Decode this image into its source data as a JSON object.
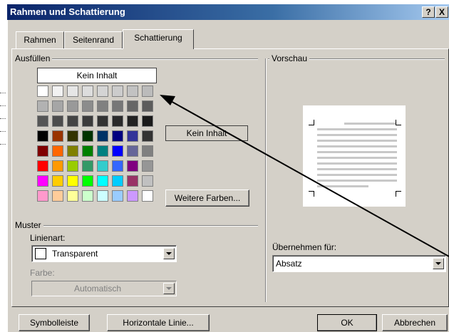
{
  "dialog": {
    "title": "Rahmen und Schattierung",
    "help_label": "?",
    "close_label": "X"
  },
  "tabs": [
    {
      "label": "Rahmen",
      "selected": false
    },
    {
      "label": "Seitenrand",
      "selected": false
    },
    {
      "label": "Schattierung",
      "selected": true
    }
  ],
  "fill": {
    "group_label": "Ausfüllen",
    "no_fill_label": "Kein Inhalt",
    "selected_label": "Kein Inhalt",
    "more_colors_label": "Weitere Farben...",
    "palette": [
      [
        "#ffffff",
        "#f2f2f2",
        "#e6e6e6",
        "#dddddd",
        "#d4d4d4",
        "#cccccc",
        "#c2c2c2",
        "#bbbbbb"
      ],
      [
        "#b2b2b2",
        "#a6a6a6",
        "#999999",
        "#8c8c8c",
        "#808080",
        "#777777",
        "#666666",
        "#5c5c5c"
      ],
      [
        "#555555",
        "#4c4c4c",
        "#444444",
        "#3b3b3b",
        "#333333",
        "#2a2a2a",
        "#222222",
        "#1a1a1a"
      ],
      [
        "#000000",
        "#993300",
        "#333300",
        "#003300",
        "#003366",
        "#000080",
        "#333399",
        "#333333"
      ],
      [
        "#800000",
        "#ff6600",
        "#808000",
        "#008000",
        "#008080",
        "#0000ff",
        "#666699",
        "#808080"
      ],
      [
        "#ff0000",
        "#ff9900",
        "#99cc00",
        "#339966",
        "#33cccc",
        "#3366ff",
        "#800080",
        "#969696"
      ],
      [
        "#ff00ff",
        "#ffcc00",
        "#ffff00",
        "#00ff00",
        "#00ffff",
        "#00ccff",
        "#993366",
        "#c0c0c0"
      ],
      [
        "#ff99cc",
        "#ffcc99",
        "#ffff99",
        "#ccffcc",
        "#ccffff",
        "#99ccff",
        "#cc99ff",
        "#ffffff"
      ]
    ]
  },
  "pattern": {
    "group_label": "Muster",
    "style_label": "Linienart:",
    "style_value": "Transparent",
    "color_label": "Farbe:",
    "color_value": "Automatisch"
  },
  "preview": {
    "group_label": "Vorschau",
    "apply_label": "Übernehmen für:",
    "apply_value": "Absatz"
  },
  "footer": {
    "toolbar_label": "Symbolleiste",
    "hline_label": "Horizontale Linie...",
    "ok_label": "OK",
    "cancel_label": "Abbrechen"
  },
  "colors": {
    "titlebar": "#0a246a",
    "face": "#d4d0c8",
    "arrow": "#000000"
  }
}
